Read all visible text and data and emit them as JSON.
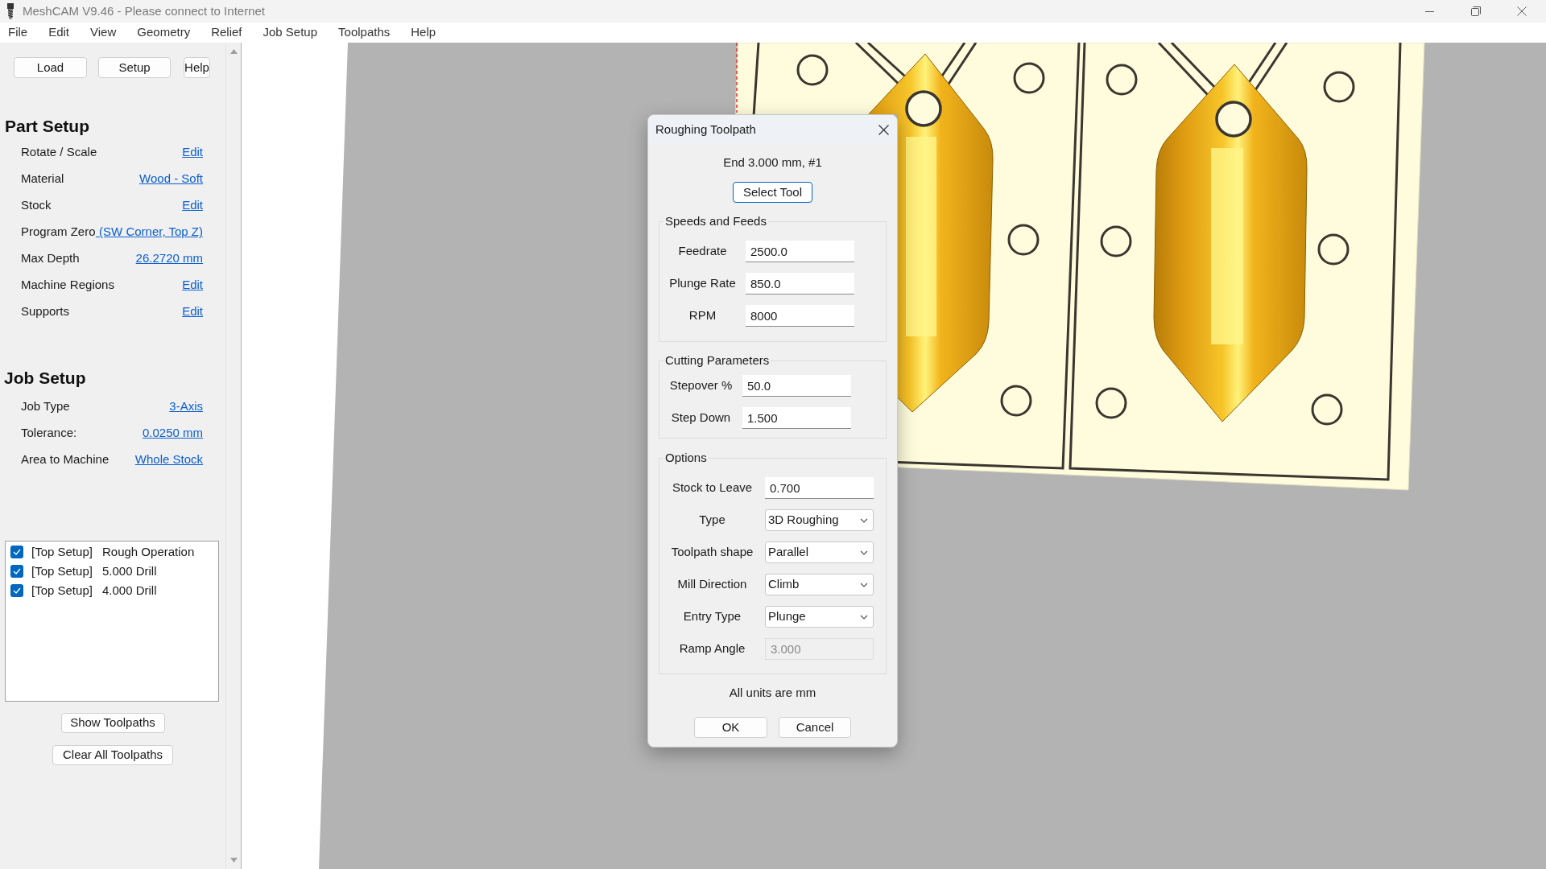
{
  "window": {
    "title": "MeshCAM V9.46 - Please connect to Internet"
  },
  "menu": [
    "File",
    "Edit",
    "View",
    "Geometry",
    "Relief",
    "Job Setup",
    "Toolpaths",
    "Help"
  ],
  "toolbar": [
    "Load",
    "Setup",
    "Help"
  ],
  "part_setup": {
    "title": "Part Setup",
    "rows": [
      {
        "label": "Rotate / Scale",
        "value": "Edit"
      },
      {
        "label": "Material",
        "value": "Wood - Soft"
      },
      {
        "label": "Stock",
        "value": "Edit"
      },
      {
        "label": "Program Zero",
        "value": " (SW Corner, Top Z)"
      },
      {
        "label": "Max Depth",
        "value": "26.2720 mm"
      },
      {
        "label": "Machine Regions",
        "value": "Edit"
      },
      {
        "label": "Supports",
        "value": "Edit"
      }
    ]
  },
  "job_setup": {
    "title": "Job Setup",
    "rows": [
      {
        "label": "Job Type",
        "value": "3-Axis"
      },
      {
        "label": "Tolerance:",
        "value": "0.0250 mm"
      },
      {
        "label": "Area to Machine",
        "value": "Whole Stock"
      }
    ]
  },
  "operations": [
    {
      "setup": "[Top Setup]",
      "name": "Rough Operation",
      "checked": true
    },
    {
      "setup": "[Top Setup]",
      "name": "5.000 Drill",
      "checked": true
    },
    {
      "setup": "[Top Setup]",
      "name": "4.000 Drill",
      "checked": true
    }
  ],
  "panel_buttons": [
    "Show Toolpaths",
    "Clear All Toolpaths"
  ],
  "dialog": {
    "title": "Roughing Toolpath",
    "tool": "End 3.000 mm, #1",
    "select_button": "Select Tool",
    "groups": [
      {
        "title": "Speeds and Feeds",
        "fields": [
          {
            "label": "Feedrate",
            "value": "2500.0",
            "kind": "text",
            "disabled": false
          },
          {
            "label": "Plunge Rate",
            "value": "850.0",
            "kind": "text",
            "disabled": false
          },
          {
            "label": "RPM",
            "value": "8000",
            "kind": "text",
            "disabled": false
          }
        ]
      },
      {
        "title": "Cutting Parameters",
        "fields": [
          {
            "label": "Stepover %",
            "value": "50.0",
            "kind": "text",
            "disabled": false
          },
          {
            "label": "Step Down",
            "value": "1.500",
            "kind": "text",
            "disabled": false
          }
        ]
      },
      {
        "title": "Options",
        "fields": [
          {
            "label": "Stock to Leave",
            "value": "0.700",
            "kind": "text",
            "disabled": false
          },
          {
            "label": "Type",
            "value": "3D Roughing",
            "kind": "select",
            "disabled": false
          },
          {
            "label": "Toolpath shape",
            "value": "Parallel",
            "kind": "select",
            "disabled": false
          },
          {
            "label": "Mill Direction",
            "value": "Climb",
            "kind": "select",
            "disabled": false
          },
          {
            "label": "Entry Type",
            "value": "Plunge",
            "kind": "select",
            "disabled": false
          },
          {
            "label": "Ramp Angle",
            "value": "3.000",
            "kind": "text",
            "disabled": true
          }
        ]
      }
    ],
    "note": "All units are mm",
    "buttons": [
      "OK",
      "Cancel"
    ]
  }
}
